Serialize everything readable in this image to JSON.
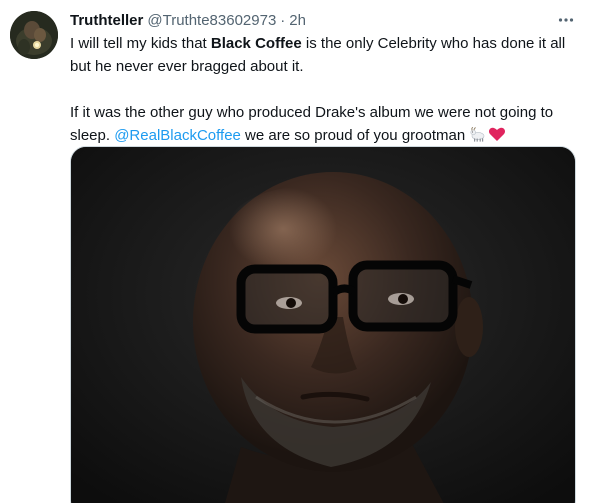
{
  "tweet": {
    "display_name": "Truthteller",
    "handle": "@Truthte83602973",
    "separator": "·",
    "time": "2h",
    "paragraph1": {
      "part1": "I will tell my kids that ",
      "bold": "Black Coffee",
      "part2": " is the only Celebrity who has done it all but he never ever bragged about it."
    },
    "paragraph2": {
      "part1": "If it was the other guy who produced Drake's album we were not going to sleep. ",
      "mention": "@RealBlackCoffee",
      "part2": " we are so proud of you grootman"
    },
    "emojis": [
      "goat-icon",
      "red-heart-icon"
    ],
    "media": "photo"
  },
  "colors": {
    "text": "#0f1419",
    "secondary": "#536471",
    "link": "#1d9bf0",
    "heart": "#e0245e"
  }
}
